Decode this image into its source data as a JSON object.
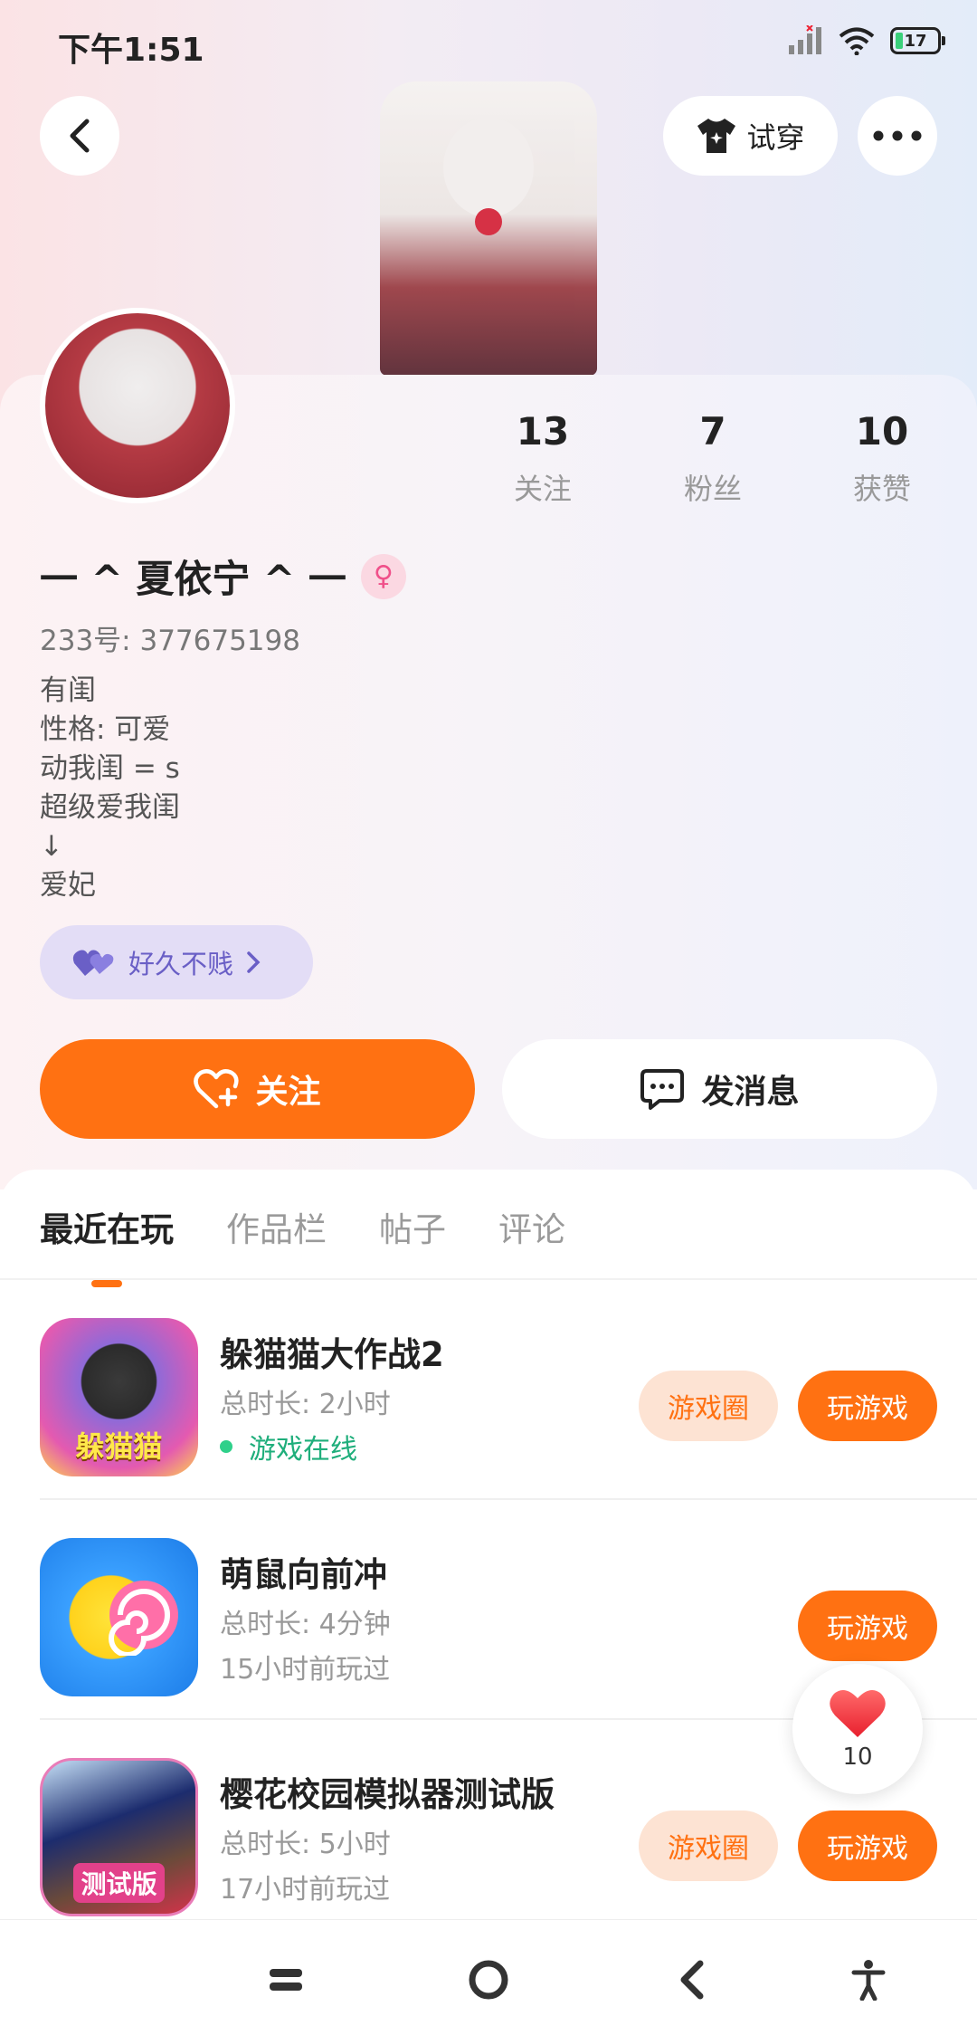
{
  "status_bar": {
    "time": "下午1:51",
    "battery": "17"
  },
  "header": {
    "tryon_label": "试穿"
  },
  "profile": {
    "username": "一 ^ 夏依宁 ^ 一",
    "gender_symbol": "♀",
    "uid": "233号: 377675198",
    "bio_lines": [
      "有闺",
      "性格: 可爱",
      "动我闺 = s",
      "超级爱我闺",
      "↓",
      "爱妃"
    ],
    "tag_label": "好久不贱",
    "stats": [
      {
        "num": "13",
        "label": "关注"
      },
      {
        "num": "7",
        "label": "粉丝"
      },
      {
        "num": "10",
        "label": "获赞"
      }
    ]
  },
  "actions": {
    "follow_label": "关注",
    "message_label": "发消息"
  },
  "tabs": [
    "最近在玩",
    "作品栏",
    "帖子",
    "评论"
  ],
  "games": [
    {
      "title": "躲猫猫大作战2",
      "duration": "总时长: 2小时",
      "status": "游戏在线",
      "icon_text": "躲猫猫",
      "circle_label": "游戏圈",
      "play_label": "玩游戏"
    },
    {
      "title": "萌鼠向前冲",
      "duration": "总时长: 4分钟",
      "status": "15小时前玩过",
      "play_label": "玩游戏"
    },
    {
      "title": "樱花校园模拟器测试版",
      "duration": "总时长: 5小时",
      "status": "17小时前玩过",
      "icon_text": "测试版",
      "circle_label": "游戏圈",
      "play_label": "玩游戏"
    }
  ],
  "like_float": {
    "count": "10"
  },
  "colors": {
    "accent": "#ff7112",
    "online": "#1fae7b",
    "tag_purple": "#6a5fc6"
  }
}
